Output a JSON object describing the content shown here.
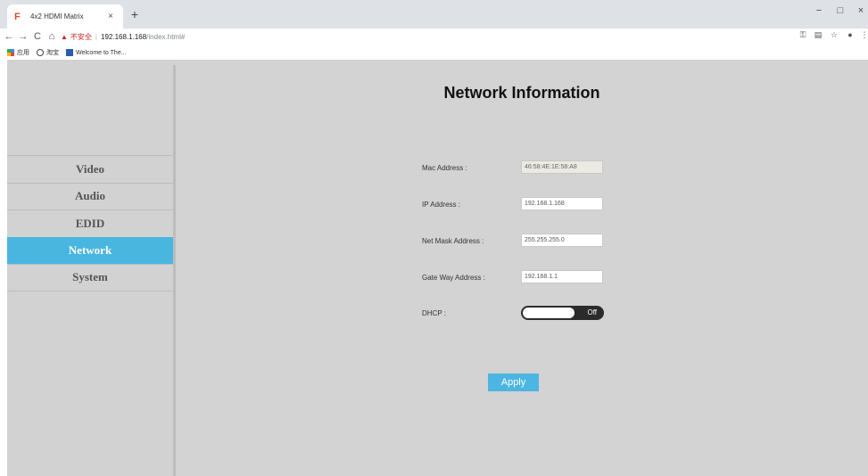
{
  "browser": {
    "tab_title": "4x2 HDMI Matrix",
    "tab_favicon": "F",
    "tab_close": "×",
    "new_tab": "+",
    "minimize": "−",
    "maximize": "□",
    "close": "×",
    "back": "←",
    "forward": "→",
    "reload": "C",
    "home": "⌂",
    "security_warning": "不安全",
    "url_host": "192.168.1.168",
    "url_path": "/index.html#",
    "bookmarks": [
      {
        "label": "应用"
      },
      {
        "label": "淘宝"
      },
      {
        "label": "Welcome to The..."
      }
    ],
    "icons": [
      "key-icon",
      "translate-icon",
      "star-icon",
      "profile-icon",
      "menu-icon"
    ]
  },
  "sidebar": {
    "items": [
      {
        "label": "Video",
        "active": false
      },
      {
        "label": "Audio",
        "active": false
      },
      {
        "label": "EDID",
        "active": false
      },
      {
        "label": "Network",
        "active": true
      },
      {
        "label": "System",
        "active": false
      }
    ],
    "active_color": "#49b6e0"
  },
  "network": {
    "title": "Network Information",
    "mac_label": "Mac Address :",
    "mac_value": "46:58:4E:1E:58:A8",
    "ip_label": "IP Address :",
    "ip_value": "192.168.1.168",
    "mask_label": "Net Mask Address :",
    "mask_value": "255.255.255.0",
    "gateway_label": "Gate Way Address :",
    "gateway_value": "192.168.1.1",
    "dhcp_label": "DHCP :",
    "dhcp_state": "Off",
    "apply_label": "Apply"
  }
}
